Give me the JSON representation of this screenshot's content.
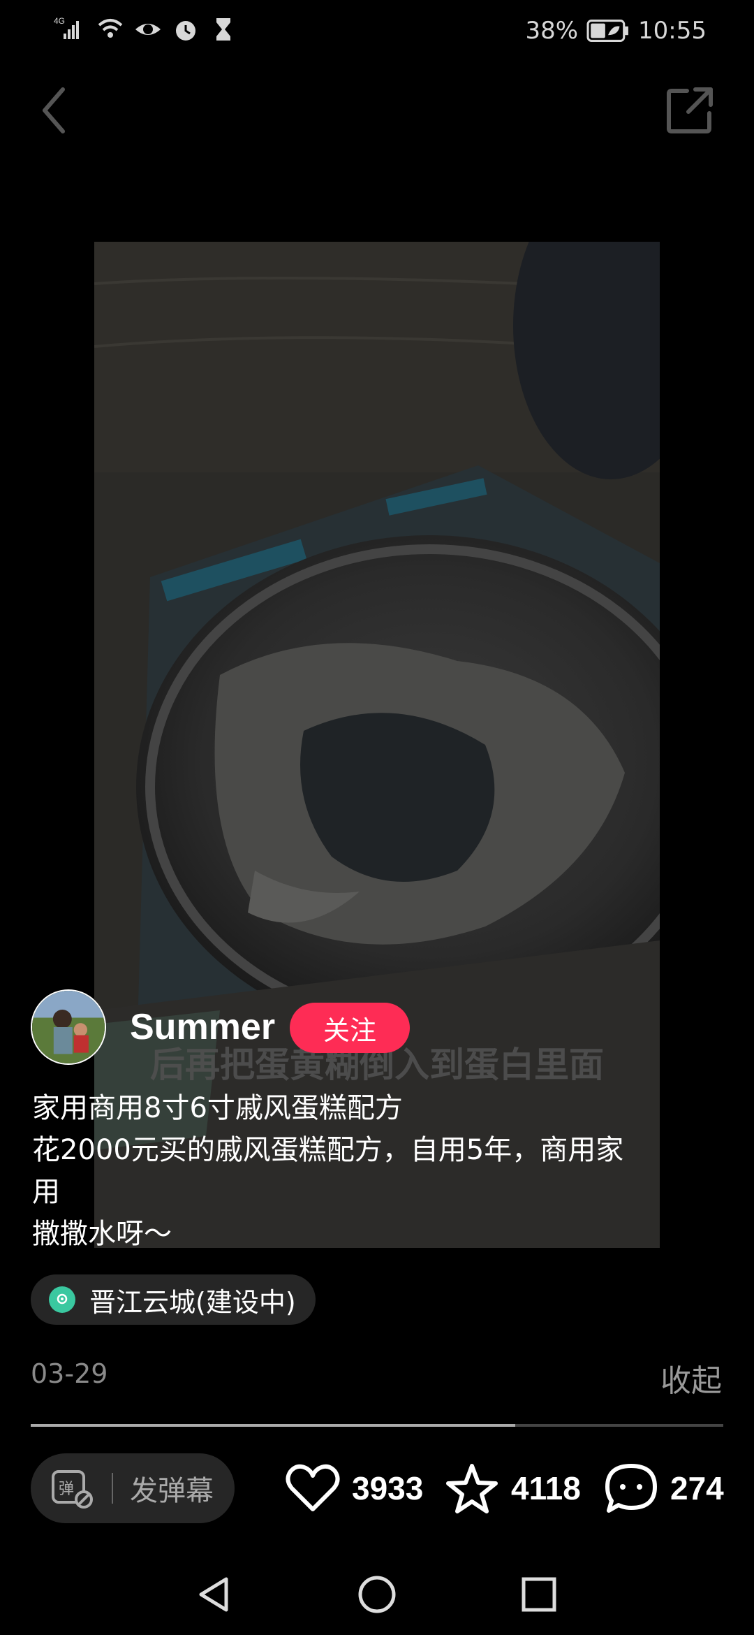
{
  "status_bar": {
    "network": "4G",
    "battery": "38%",
    "time": "10:55"
  },
  "post": {
    "author": "Summer",
    "follow_label": "关注",
    "video_caption": "后再把蛋黄糊倒入到蛋白里面",
    "description_lines": [
      "家用商用8寸6寸戚风蛋糕配方",
      "花2000元买的戚风蛋糕配方，自用5年，商用家",
      "用",
      "撒撒水呀～"
    ],
    "location": "晋江云城(建设中)",
    "date": "03-29",
    "collapse_label": "收起",
    "progress": 0.7
  },
  "actions": {
    "danmaku_placeholder": "发弹幕",
    "likes": "3933",
    "favorites": "4118",
    "comments": "274"
  },
  "icons": {
    "back": "chevron-left-icon",
    "share": "share-icon",
    "like": "heart-icon",
    "favorite": "star-icon",
    "comment": "comment-icon",
    "danmaku": "danmaku-icon",
    "location": "location-pin-icon"
  },
  "colors": {
    "follow_button": "#fe2c55",
    "location_icon": "#3ac8a0",
    "background": "#000000"
  }
}
